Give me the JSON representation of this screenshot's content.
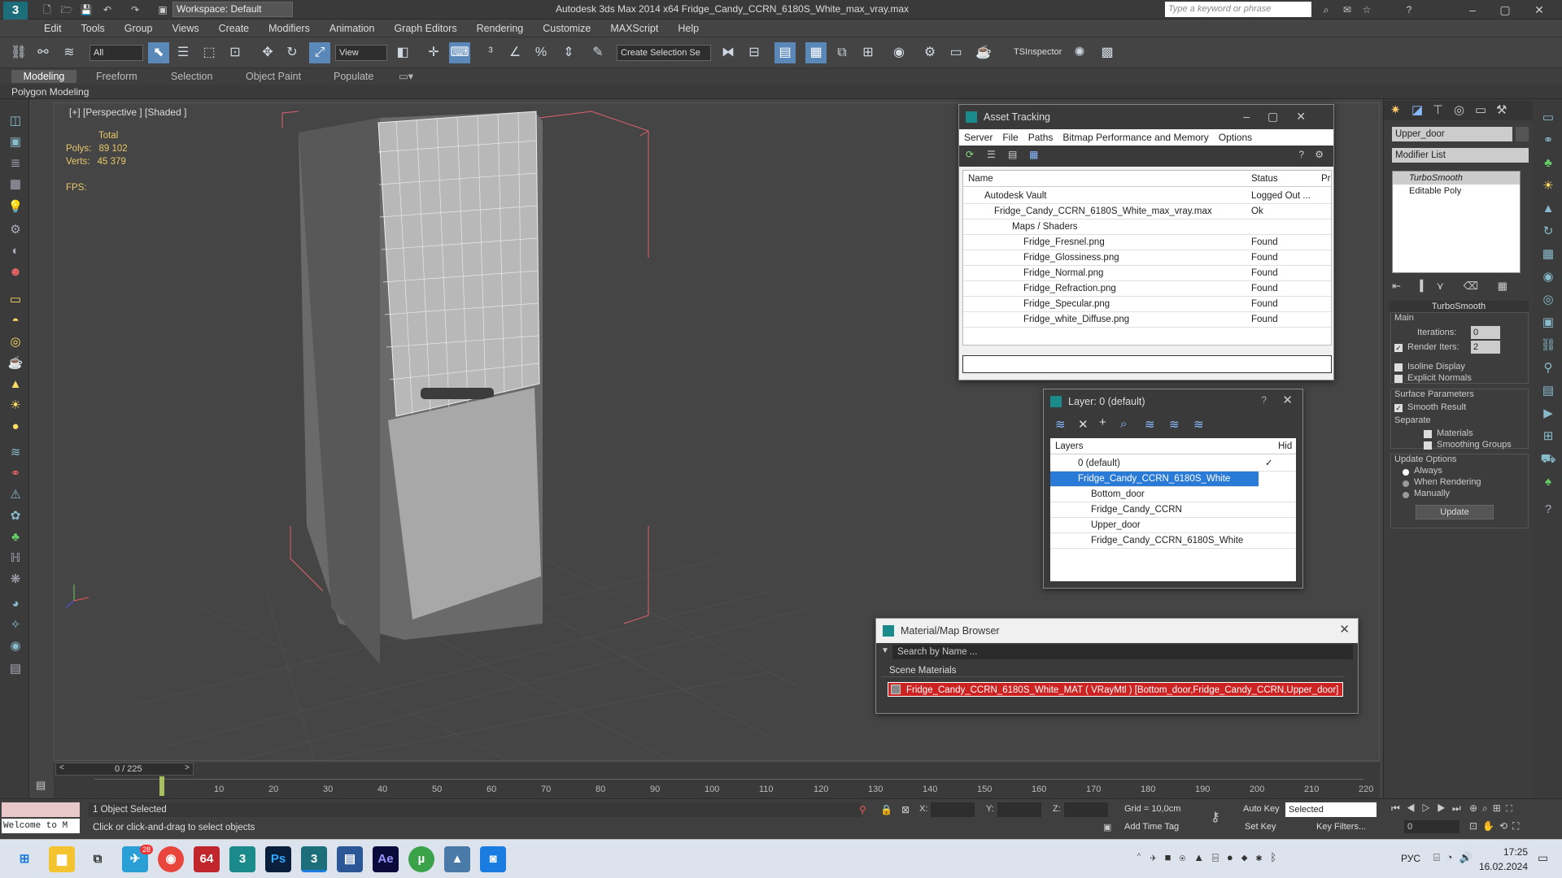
{
  "titlebar": {
    "workspace": "Workspace: Default",
    "app_title": "Autodesk 3ds Max  2014 x64     Fridge_Candy_CCRN_6180S_White_max_vray.max",
    "search_placeholder": "Type a keyword or phrase"
  },
  "menu": [
    "Edit",
    "Tools",
    "Group",
    "Views",
    "Create",
    "Modifiers",
    "Animation",
    "Graph Editors",
    "Rendering",
    "Customize",
    "MAXScript",
    "Help"
  ],
  "toolbar": {
    "filter": "All",
    "coordsys": "View",
    "selection_set": "Create Selection Se",
    "tsinspector": "TSInspector"
  },
  "ribbon_tabs": [
    "Modeling",
    "Freeform",
    "Selection",
    "Object Paint",
    "Populate"
  ],
  "ribbon_label": "Polygon Modeling",
  "viewport": {
    "label": "[+] [Perspective ] [Shaded ]",
    "stats_total": "Total",
    "polys_label": "Polys:",
    "polys": "89 102",
    "verts_label": "Verts:",
    "verts": "45 379",
    "fps": "FPS:"
  },
  "asset_tracking": {
    "title": "Asset Tracking",
    "menu": [
      "Server",
      "File",
      "Paths",
      "Bitmap Performance and Memory",
      "Options"
    ],
    "col_name": "Name",
    "col_status": "Status",
    "col_pr": "Pr",
    "rows": [
      {
        "name": "Autodesk Vault",
        "status": "Logged Out ..."
      },
      {
        "name": "Fridge_Candy_CCRN_6180S_White_max_vray.max",
        "status": "Ok"
      },
      {
        "name": "Maps / Shaders",
        "status": ""
      },
      {
        "name": "Fridge_Fresnel.png",
        "status": "Found"
      },
      {
        "name": "Fridge_Glossiness.png",
        "status": "Found"
      },
      {
        "name": "Fridge_Normal.png",
        "status": "Found"
      },
      {
        "name": "Fridge_Refraction.png",
        "status": "Found"
      },
      {
        "name": "Fridge_Specular.png",
        "status": "Found"
      },
      {
        "name": "Fridge_white_Diffuse.png",
        "status": "Found"
      }
    ]
  },
  "layer": {
    "title": "Layer: 0 (default)",
    "col_layers": "Layers",
    "col_hide": "Hid",
    "rows": [
      "0 (default)",
      "Fridge_Candy_CCRN_6180S_White",
      "Bottom_door",
      "Fridge_Candy_CCRN",
      "Upper_door",
      "Fridge_Candy_CCRN_6180S_White"
    ]
  },
  "material_browser": {
    "title": "Material/Map Browser",
    "search_placeholder": "Search by Name ...",
    "section": "Scene Materials",
    "material": "Fridge_Candy_CCRN_6180S_White_MAT ( VRayMtl ) [Bottom_door,Fridge_Candy_CCRN,Upper_door]"
  },
  "command_panel": {
    "object_name": "Upper_door",
    "modifier_list": "Modifier List",
    "stack": [
      "TurboSmooth",
      "Editable Poly"
    ],
    "rollout": "TurboSmooth",
    "main": "Main",
    "iterations_label": "Iterations:",
    "iterations": "0",
    "render_iters_label": "Render Iters:",
    "render_iters": "2",
    "isoline": "Isoline Display",
    "explicit_normals": "Explicit Normals",
    "surface_params": "Surface Parameters",
    "smooth_result": "Smooth Result",
    "separate": "Separate",
    "materials": "Materials",
    "smoothing_groups": "Smoothing Groups",
    "update_options": "Update Options",
    "always": "Always",
    "when_rendering": "When Rendering",
    "manually": "Manually",
    "update_btn": "Update"
  },
  "timeline": {
    "frame": "0 / 225",
    "ticks": [
      "0",
      "10",
      "20",
      "30",
      "40",
      "50",
      "60",
      "70",
      "80",
      "90",
      "100",
      "110",
      "120",
      "130",
      "140",
      "150",
      "160",
      "170",
      "180",
      "190",
      "200",
      "210",
      "220"
    ]
  },
  "status": {
    "listener": "Welcome to M",
    "selected": "1 Object Selected",
    "prompt": "Click or click-and-drag to select objects",
    "x_label": "X:",
    "y_label": "Y:",
    "z_label": "Z:",
    "grid": "Grid = 10,0cm",
    "auto_key": "Auto Key",
    "set_key": "Set Key",
    "key_mode": "Selected",
    "key_filters": "Key Filters...",
    "add_time_tag": "Add Time Tag",
    "frame_field": "0"
  },
  "taskbar": {
    "lang": "РУС",
    "time": "17:25",
    "date": "16.02.2024",
    "badge": "28"
  }
}
